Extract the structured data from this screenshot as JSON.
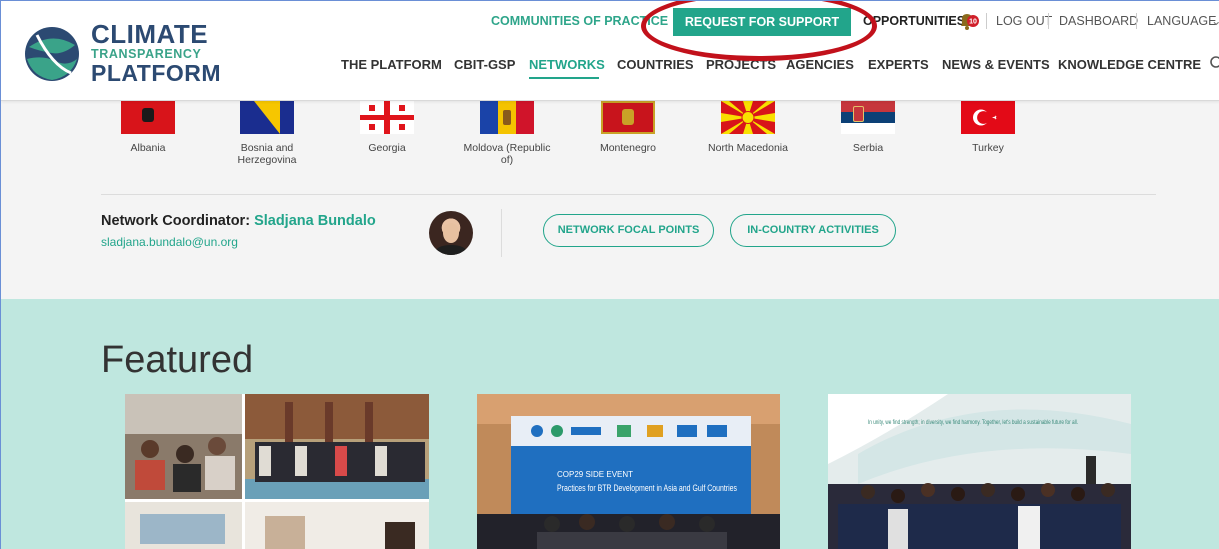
{
  "header": {
    "logo": {
      "line1": "CLIMATE",
      "line2": "TRANSPARENCY",
      "line3": "PLATFORM"
    },
    "topbar": {
      "communities": "COMMUNITIES OF PRACTICE",
      "request": "REQUEST FOR SUPPORT",
      "opportunities": "OPPORTUNITIES",
      "notifications_count": "10",
      "logout": "LOG OUT",
      "dashboard": "DASHBOARD",
      "language": "LANGUAGE"
    },
    "nav": [
      {
        "label": "THE PLATFORM"
      },
      {
        "label": "CBIT-GSP"
      },
      {
        "label": "NETWORKS"
      },
      {
        "label": "COUNTRIES"
      },
      {
        "label": "PROJECTS"
      },
      {
        "label": "AGENCIES"
      },
      {
        "label": "EXPERTS"
      },
      {
        "label": "NEWS & EVENTS"
      },
      {
        "label": "KNOWLEDGE CENTRE"
      }
    ]
  },
  "flags": [
    {
      "name": "Albania"
    },
    {
      "name": "Bosnia and Herzegovina"
    },
    {
      "name": "Georgia"
    },
    {
      "name": "Moldova (Republic of)"
    },
    {
      "name": "Montenegro"
    },
    {
      "name": "North Macedonia"
    },
    {
      "name": "Serbia"
    },
    {
      "name": "Turkey"
    }
  ],
  "coordinator": {
    "label": "Network Coordinator:",
    "name": "Sladjana Bundalo",
    "email": "sladjana.bundalo@un.org"
  },
  "buttons": {
    "focal_points": "NETWORK FOCAL POINTS",
    "activities": "IN-COUNTRY ACTIVITIES"
  },
  "featured": {
    "title": "Featured",
    "card2_title": "Practices for BTR Development in Asia and Gulf Countries",
    "card2_event": "COP29 SIDE EVENT",
    "card3_quote": "In unity, we find strength; in diversity, we find harmony. Together, let's build a sustainable future for all."
  },
  "colors": {
    "accent": "#22a58b",
    "navy": "#2c4a72",
    "highlight": "#c2111b",
    "featured_bg": "#bfe7df"
  }
}
